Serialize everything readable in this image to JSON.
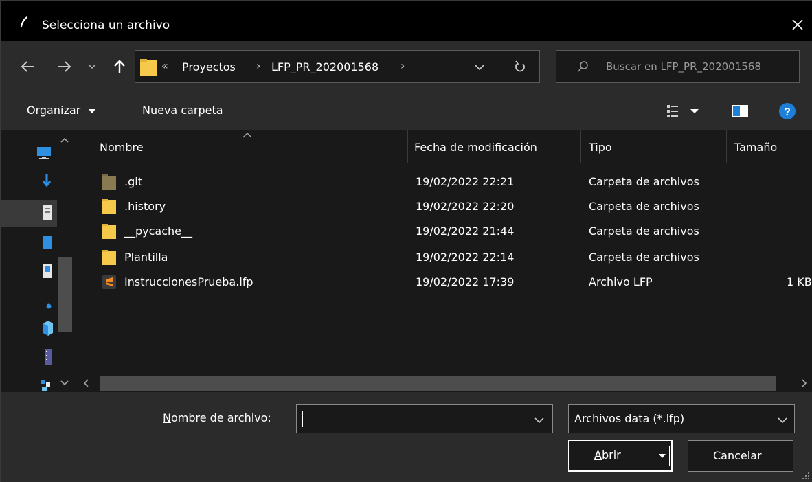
{
  "window": {
    "title": "Selecciona un archivo"
  },
  "nav": {
    "breadcrumb_prefix": "«",
    "breadcrumbs": [
      "Proyectos",
      "LFP_PR_202001568"
    ],
    "search_placeholder": "Buscar en LFP_PR_202001568"
  },
  "toolbar": {
    "organize_label": "Organizar",
    "new_folder_label": "Nueva carpeta"
  },
  "columns": {
    "name": "Nombre",
    "modified": "Fecha de modificación",
    "type": "Tipo",
    "size": "Tamaño"
  },
  "files": [
    {
      "name": ".git",
      "modified": "19/02/2022 22:21",
      "type": "Carpeta de archivos",
      "size": "",
      "icon": "folder-dark-icon"
    },
    {
      "name": ".history",
      "modified": "19/02/2022 22:20",
      "type": "Carpeta de archivos",
      "size": "",
      "icon": "folder-icon"
    },
    {
      "name": "__pycache__",
      "modified": "19/02/2022 21:44",
      "type": "Carpeta de archivos",
      "size": "",
      "icon": "folder-icon"
    },
    {
      "name": "Plantilla",
      "modified": "19/02/2022 22:14",
      "type": "Carpeta de archivos",
      "size": "",
      "icon": "folder-icon"
    },
    {
      "name": "InstruccionesPrueba.lfp",
      "modified": "19/02/2022 17:39",
      "type": "Archivo LFP",
      "size": "1 KB",
      "icon": "sublime-file-icon"
    }
  ],
  "bottom": {
    "filename_label_underlined": "N",
    "filename_label_rest": "ombre de archivo:",
    "filename_value": "",
    "filetype_value": "Archivos data (*.lfp)",
    "open_label_underlined": "A",
    "open_label_rest": "brir",
    "cancel_label": "Cancelar"
  },
  "colors": {
    "title_bg": "#000000",
    "chrome_bg": "#2b2b2b",
    "content_bg": "#191919",
    "folder_yellow": "#f6c94a",
    "folder_dark": "#8a7a52",
    "help_blue": "#1e7fd8",
    "sublime_orange": "#f38a1f"
  }
}
